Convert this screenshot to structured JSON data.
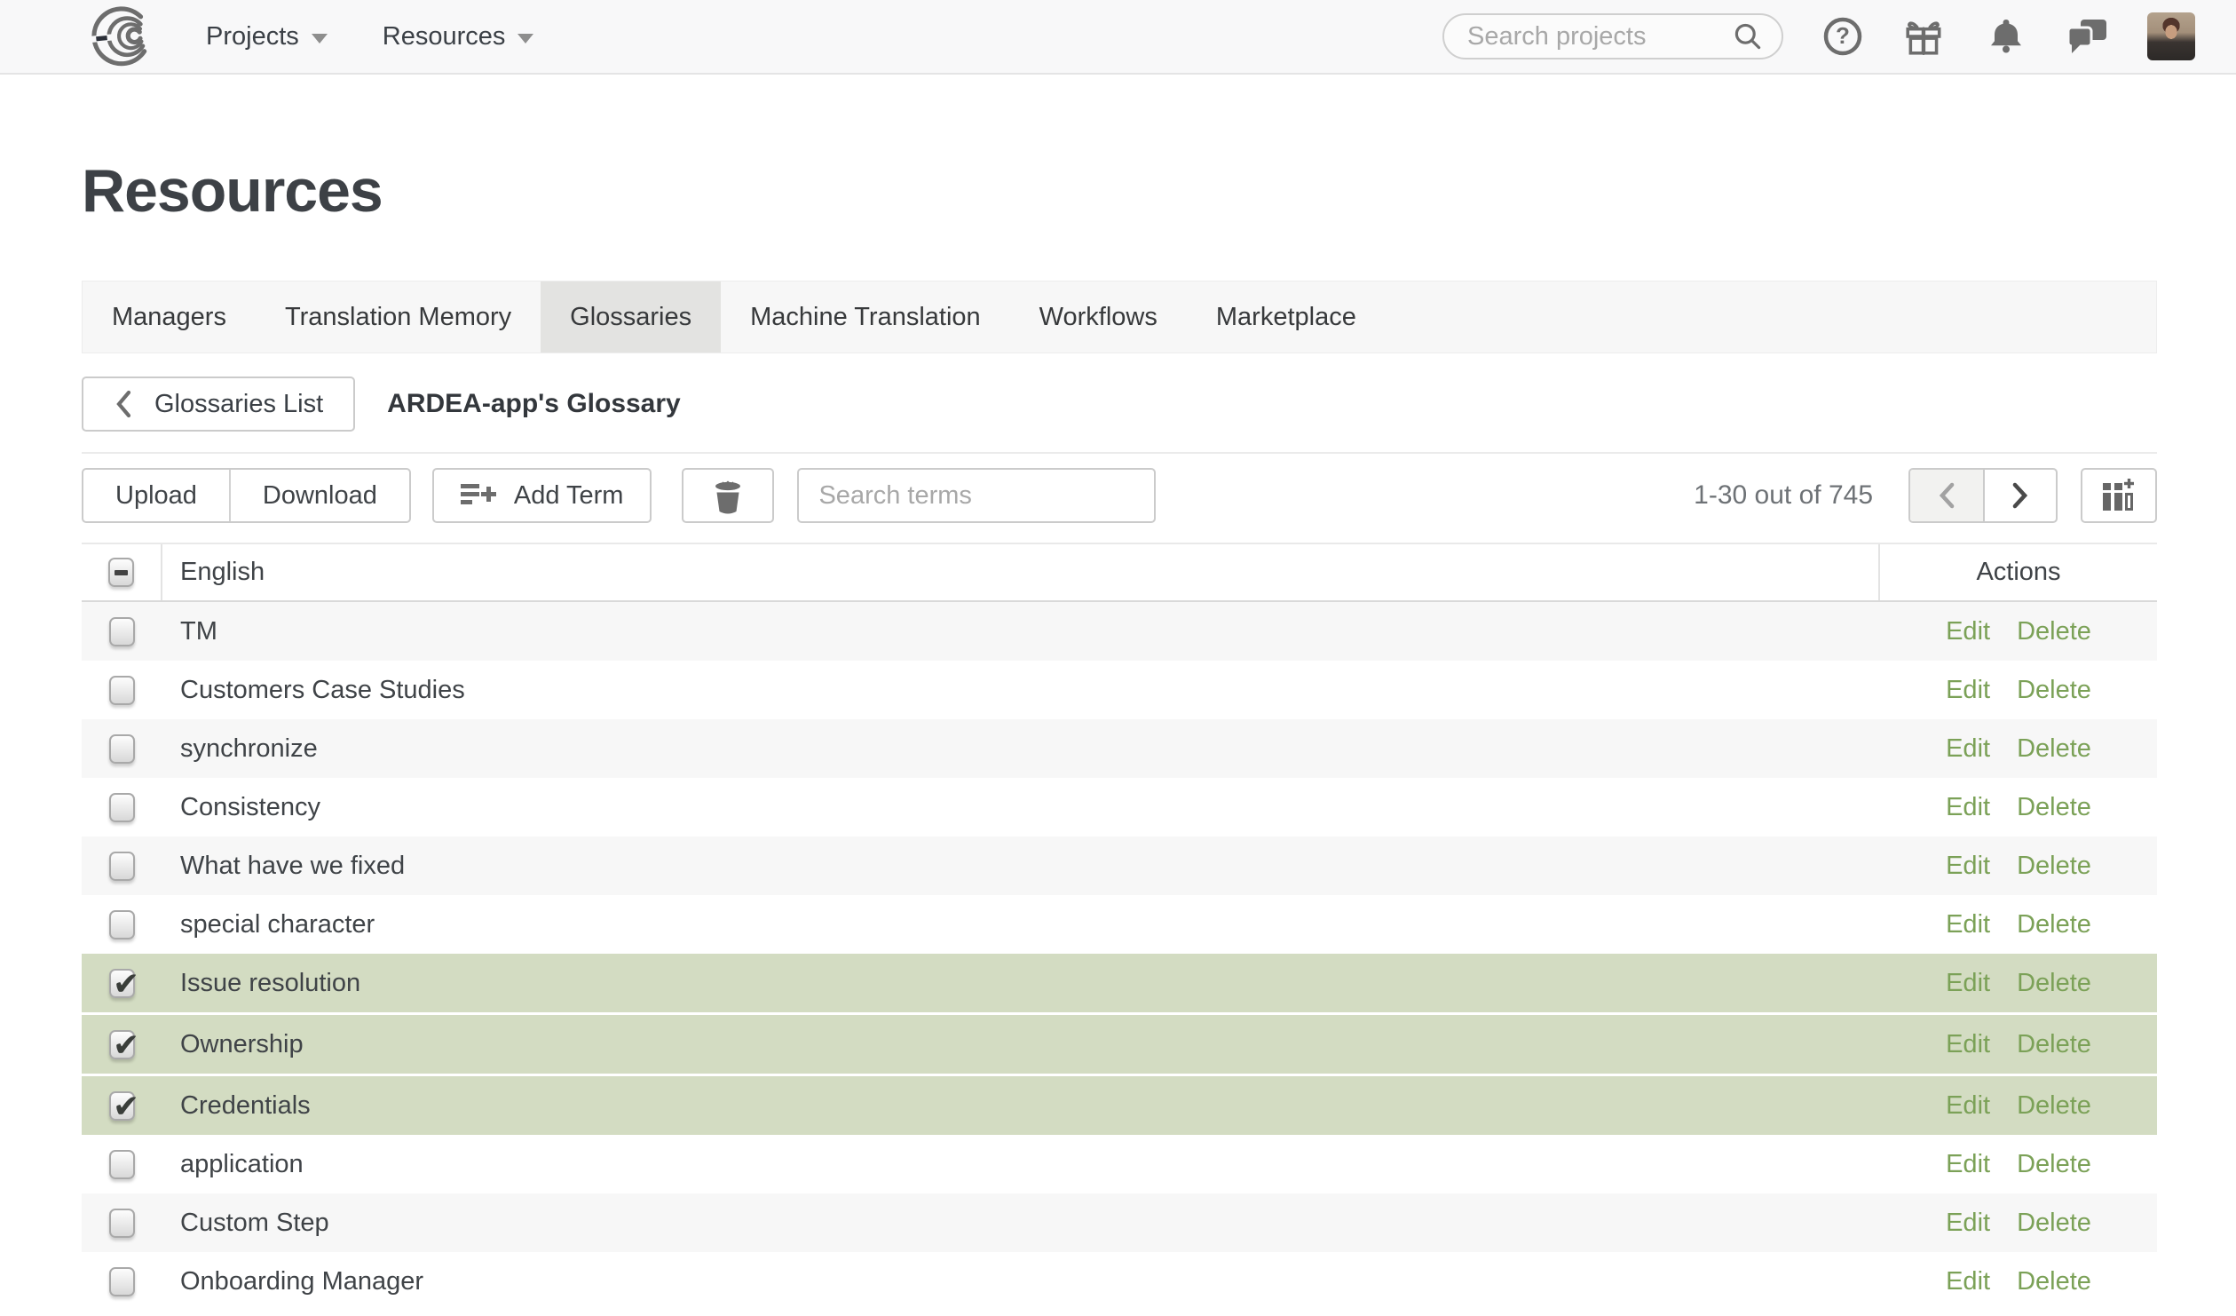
{
  "topnav": {
    "menus": [
      {
        "label": "Projects"
      },
      {
        "label": "Resources"
      }
    ],
    "search_placeholder": "Search projects",
    "icons": [
      "help-icon",
      "gift-icon",
      "bell-icon",
      "chat-icon",
      "avatar"
    ]
  },
  "page": {
    "title": "Resources"
  },
  "tabs": [
    {
      "label": "Managers",
      "active": false
    },
    {
      "label": "Translation Memory",
      "active": false
    },
    {
      "label": "Glossaries",
      "active": true
    },
    {
      "label": "Machine Translation",
      "active": false
    },
    {
      "label": "Workflows",
      "active": false
    },
    {
      "label": "Marketplace",
      "active": false
    }
  ],
  "breadcrumb": {
    "back_label": "Glossaries List",
    "current": "ARDEA-app's Glossary"
  },
  "toolbar": {
    "upload_label": "Upload",
    "download_label": "Download",
    "add_term_label": "Add Term",
    "search_placeholder": "Search terms",
    "range_text": "1-30 out of 745"
  },
  "table": {
    "columns": {
      "term": "English",
      "actions": "Actions"
    },
    "row_actions": {
      "edit": "Edit",
      "delete": "Delete"
    },
    "rows": [
      {
        "term": "TM",
        "checked": false
      },
      {
        "term": "Customers Case Studies",
        "checked": false
      },
      {
        "term": "synchronize",
        "checked": false
      },
      {
        "term": "Consistency",
        "checked": false
      },
      {
        "term": "What have we fixed",
        "checked": false
      },
      {
        "term": "special character",
        "checked": false
      },
      {
        "term": "Issue resolution",
        "checked": true
      },
      {
        "term": "Ownership",
        "checked": true
      },
      {
        "term": "Credentials",
        "checked": true
      },
      {
        "term": "application",
        "checked": false
      },
      {
        "term": "Custom Step",
        "checked": false
      },
      {
        "term": "Onboarding Manager",
        "checked": false
      }
    ]
  },
  "colors": {
    "selected_row": "#d3dcc2",
    "action_link_green": "#7ba157",
    "row_stripe": "#f7f7f7",
    "topbar_bg": "#f8f8f9",
    "active_tab_bg": "#e3e3e1"
  }
}
